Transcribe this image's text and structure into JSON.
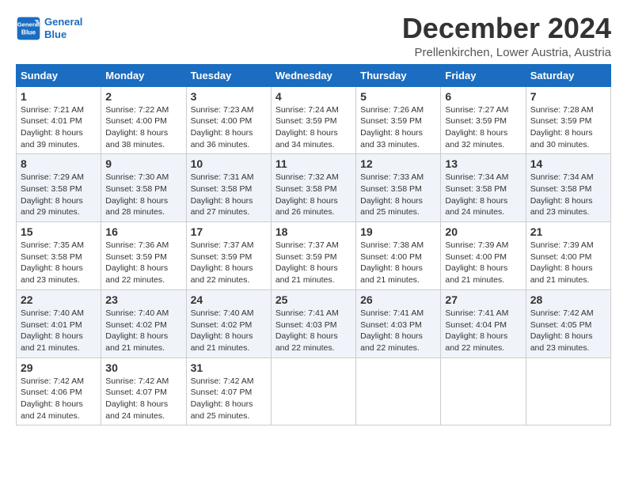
{
  "header": {
    "logo_line1": "General",
    "logo_line2": "Blue",
    "title": "December 2024",
    "subtitle": "Prellenkirchen, Lower Austria, Austria"
  },
  "weekdays": [
    "Sunday",
    "Monday",
    "Tuesday",
    "Wednesday",
    "Thursday",
    "Friday",
    "Saturday"
  ],
  "weeks": [
    [
      {
        "day": "1",
        "sunrise": "7:21 AM",
        "sunset": "4:01 PM",
        "daylight": "8 hours and 39 minutes."
      },
      {
        "day": "2",
        "sunrise": "7:22 AM",
        "sunset": "4:00 PM",
        "daylight": "8 hours and 38 minutes."
      },
      {
        "day": "3",
        "sunrise": "7:23 AM",
        "sunset": "4:00 PM",
        "daylight": "8 hours and 36 minutes."
      },
      {
        "day": "4",
        "sunrise": "7:24 AM",
        "sunset": "3:59 PM",
        "daylight": "8 hours and 34 minutes."
      },
      {
        "day": "5",
        "sunrise": "7:26 AM",
        "sunset": "3:59 PM",
        "daylight": "8 hours and 33 minutes."
      },
      {
        "day": "6",
        "sunrise": "7:27 AM",
        "sunset": "3:59 PM",
        "daylight": "8 hours and 32 minutes."
      },
      {
        "day": "7",
        "sunrise": "7:28 AM",
        "sunset": "3:59 PM",
        "daylight": "8 hours and 30 minutes."
      }
    ],
    [
      {
        "day": "8",
        "sunrise": "7:29 AM",
        "sunset": "3:58 PM",
        "daylight": "8 hours and 29 minutes."
      },
      {
        "day": "9",
        "sunrise": "7:30 AM",
        "sunset": "3:58 PM",
        "daylight": "8 hours and 28 minutes."
      },
      {
        "day": "10",
        "sunrise": "7:31 AM",
        "sunset": "3:58 PM",
        "daylight": "8 hours and 27 minutes."
      },
      {
        "day": "11",
        "sunrise": "7:32 AM",
        "sunset": "3:58 PM",
        "daylight": "8 hours and 26 minutes."
      },
      {
        "day": "12",
        "sunrise": "7:33 AM",
        "sunset": "3:58 PM",
        "daylight": "8 hours and 25 minutes."
      },
      {
        "day": "13",
        "sunrise": "7:34 AM",
        "sunset": "3:58 PM",
        "daylight": "8 hours and 24 minutes."
      },
      {
        "day": "14",
        "sunrise": "7:34 AM",
        "sunset": "3:58 PM",
        "daylight": "8 hours and 23 minutes."
      }
    ],
    [
      {
        "day": "15",
        "sunrise": "7:35 AM",
        "sunset": "3:58 PM",
        "daylight": "8 hours and 23 minutes."
      },
      {
        "day": "16",
        "sunrise": "7:36 AM",
        "sunset": "3:59 PM",
        "daylight": "8 hours and 22 minutes."
      },
      {
        "day": "17",
        "sunrise": "7:37 AM",
        "sunset": "3:59 PM",
        "daylight": "8 hours and 22 minutes."
      },
      {
        "day": "18",
        "sunrise": "7:37 AM",
        "sunset": "3:59 PM",
        "daylight": "8 hours and 21 minutes."
      },
      {
        "day": "19",
        "sunrise": "7:38 AM",
        "sunset": "4:00 PM",
        "daylight": "8 hours and 21 minutes."
      },
      {
        "day": "20",
        "sunrise": "7:39 AM",
        "sunset": "4:00 PM",
        "daylight": "8 hours and 21 minutes."
      },
      {
        "day": "21",
        "sunrise": "7:39 AM",
        "sunset": "4:00 PM",
        "daylight": "8 hours and 21 minutes."
      }
    ],
    [
      {
        "day": "22",
        "sunrise": "7:40 AM",
        "sunset": "4:01 PM",
        "daylight": "8 hours and 21 minutes."
      },
      {
        "day": "23",
        "sunrise": "7:40 AM",
        "sunset": "4:02 PM",
        "daylight": "8 hours and 21 minutes."
      },
      {
        "day": "24",
        "sunrise": "7:40 AM",
        "sunset": "4:02 PM",
        "daylight": "8 hours and 21 minutes."
      },
      {
        "day": "25",
        "sunrise": "7:41 AM",
        "sunset": "4:03 PM",
        "daylight": "8 hours and 22 minutes."
      },
      {
        "day": "26",
        "sunrise": "7:41 AM",
        "sunset": "4:03 PM",
        "daylight": "8 hours and 22 minutes."
      },
      {
        "day": "27",
        "sunrise": "7:41 AM",
        "sunset": "4:04 PM",
        "daylight": "8 hours and 22 minutes."
      },
      {
        "day": "28",
        "sunrise": "7:42 AM",
        "sunset": "4:05 PM",
        "daylight": "8 hours and 23 minutes."
      }
    ],
    [
      {
        "day": "29",
        "sunrise": "7:42 AM",
        "sunset": "4:06 PM",
        "daylight": "8 hours and 24 minutes."
      },
      {
        "day": "30",
        "sunrise": "7:42 AM",
        "sunset": "4:07 PM",
        "daylight": "8 hours and 24 minutes."
      },
      {
        "day": "31",
        "sunrise": "7:42 AM",
        "sunset": "4:07 PM",
        "daylight": "8 hours and 25 minutes."
      },
      null,
      null,
      null,
      null
    ]
  ],
  "labels": {
    "sunrise": "Sunrise:",
    "sunset": "Sunset:",
    "daylight": "Daylight:"
  }
}
